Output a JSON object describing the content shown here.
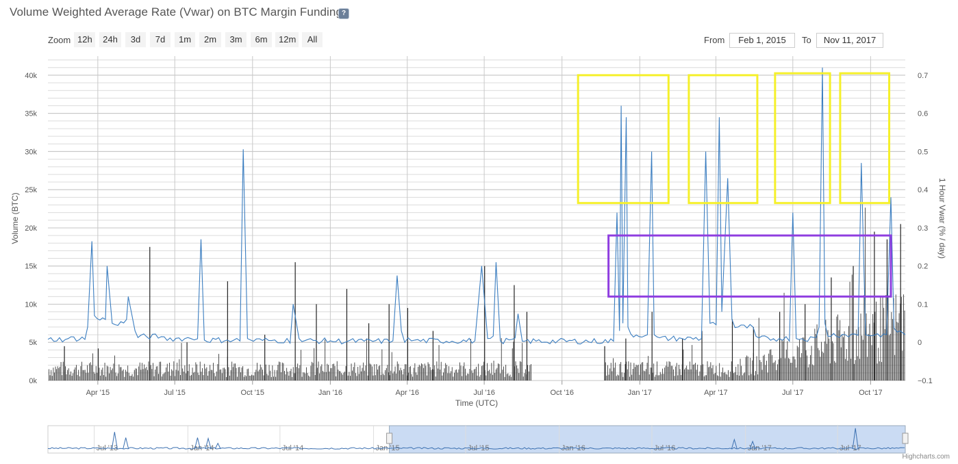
{
  "header": {
    "title": "Volume Weighted Average Rate (Vwar) on BTC Margin Funding",
    "help_icon": "help-icon"
  },
  "zoom": {
    "label": "Zoom",
    "buttons": [
      "12h",
      "24h",
      "3d",
      "7d",
      "1m",
      "2m",
      "3m",
      "6m",
      "12m",
      "All"
    ]
  },
  "range": {
    "from_label": "From",
    "from_value": "Feb 1, 2015",
    "to_label": "To",
    "to_value": "Nov 11, 2017"
  },
  "credits": "Highcharts.com",
  "chart_data": {
    "type": "line",
    "xlabel": "Time (UTC)",
    "x_ticks": [
      "Apr '15",
      "Jul '15",
      "Oct '15",
      "Jan '16",
      "Apr '16",
      "Jul '16",
      "Oct '16",
      "Jan '17",
      "Apr '17",
      "Jul '17",
      "Oct '17"
    ],
    "xlim": [
      "2015-02-01",
      "2017-11-11"
    ],
    "y_left": {
      "label": "Volume (BTC)",
      "ticks": [
        "0k",
        "5k",
        "10k",
        "15k",
        "20k",
        "25k",
        "30k",
        "35k",
        "40k"
      ],
      "ylim": [
        0,
        42500
      ]
    },
    "y_right": {
      "label": "1 Hour Vwar (% / day)",
      "ticks": [
        "−0.1",
        "0",
        "0.1",
        "0.2",
        "0.3",
        "0.4",
        "0.5",
        "0.6",
        "0.7"
      ],
      "ylim": [
        -0.1,
        0.75
      ]
    },
    "grid": true,
    "series": [
      {
        "type": "column",
        "axis": "left",
        "color": "#333333",
        "peaks": [
          [
            "2015-02-20",
            4500
          ],
          [
            "2015-04-01",
            4200
          ],
          [
            "2015-06-01",
            17500
          ],
          [
            "2015-07-15",
            5000
          ],
          [
            "2015-09-01",
            13000
          ],
          [
            "2015-10-15",
            6000
          ],
          [
            "2015-11-20",
            15500
          ],
          [
            "2015-12-15",
            10000
          ],
          [
            "2016-01-20",
            12000
          ],
          [
            "2016-02-15",
            7500
          ],
          [
            "2016-03-10",
            10000
          ],
          [
            "2016-04-01",
            9500
          ],
          [
            "2016-05-01",
            6500
          ],
          [
            "2016-07-01",
            15000
          ],
          [
            "2016-08-05",
            12500
          ],
          [
            "2016-08-20",
            9000
          ],
          [
            "2016-11-20",
            4500
          ],
          [
            "2016-12-15",
            5500
          ],
          [
            "2017-01-15",
            9000
          ],
          [
            "2017-02-20",
            5500
          ],
          [
            "2017-03-15",
            6500
          ],
          [
            "2017-04-20",
            8000
          ],
          [
            "2017-05-15",
            7000
          ],
          [
            "2017-06-15",
            9000
          ],
          [
            "2017-07-15",
            10000
          ],
          [
            "2017-08-15",
            13500
          ],
          [
            "2017-09-10",
            15000
          ],
          [
            "2017-10-05",
            19500
          ],
          [
            "2017-10-20",
            18500
          ],
          [
            "2017-11-05",
            20500
          ]
        ]
      },
      {
        "type": "line",
        "axis": "right",
        "color": "#3a7dc0",
        "points": [
          [
            "2015-02-01",
            0.008
          ],
          [
            "2015-02-25",
            0.01
          ],
          [
            "2015-03-20",
            0.04
          ],
          [
            "2015-03-25",
            0.265
          ],
          [
            "2015-03-28",
            0.07
          ],
          [
            "2015-04-10",
            0.06
          ],
          [
            "2015-04-12",
            0.2
          ],
          [
            "2015-04-18",
            0.05
          ],
          [
            "2015-05-05",
            0.06
          ],
          [
            "2015-05-07",
            0.12
          ],
          [
            "2015-05-15",
            0.03
          ],
          [
            "2015-06-15",
            0.015
          ],
          [
            "2015-07-20",
            0.01
          ],
          [
            "2015-08-01",
            0.27
          ],
          [
            "2015-08-05",
            0.006
          ],
          [
            "2015-09-01",
            0.006
          ],
          [
            "2015-09-20",
            0.506
          ],
          [
            "2015-09-25",
            0.01
          ],
          [
            "2015-10-20",
            0.005
          ],
          [
            "2015-11-18",
            0.1
          ],
          [
            "2015-11-25",
            0.01
          ],
          [
            "2016-01-01",
            0.004
          ],
          [
            "2016-02-10",
            0.003
          ],
          [
            "2016-03-15",
            0.004
          ],
          [
            "2016-03-20",
            0.175
          ],
          [
            "2016-03-25",
            0.03
          ],
          [
            "2016-04-10",
            0.006
          ],
          [
            "2016-06-20",
            0.004
          ],
          [
            "2016-06-28",
            0.2
          ],
          [
            "2016-07-05",
            0.01
          ],
          [
            "2016-07-15",
            0.21
          ],
          [
            "2016-07-20",
            0.004
          ],
          [
            "2016-08-10",
            0.075
          ],
          [
            "2016-08-15",
            0.003
          ],
          [
            "2016-12-01",
            0.003
          ],
          [
            "2016-12-05",
            0.34
          ],
          [
            "2016-12-08",
            0.03
          ],
          [
            "2016-12-10",
            0.62
          ],
          [
            "2016-12-12",
            0.05
          ],
          [
            "2016-12-16",
            0.59
          ],
          [
            "2016-12-18",
            0.04
          ],
          [
            "2017-01-10",
            0.02
          ],
          [
            "2017-01-15",
            0.5
          ],
          [
            "2017-01-18",
            0.02
          ],
          [
            "2017-02-20",
            0.01
          ],
          [
            "2017-03-15",
            0.01
          ],
          [
            "2017-03-20",
            0.5
          ],
          [
            "2017-03-25",
            0.05
          ],
          [
            "2017-04-05",
            0.59
          ],
          [
            "2017-04-08",
            0.08
          ],
          [
            "2017-04-15",
            0.43
          ],
          [
            "2017-04-20",
            0.06
          ],
          [
            "2017-05-15",
            0.04
          ],
          [
            "2017-06-15",
            0.01
          ],
          [
            "2017-07-01",
            0.34
          ],
          [
            "2017-07-05",
            0.01
          ],
          [
            "2017-08-01",
            0.04
          ],
          [
            "2017-08-05",
            0.72
          ],
          [
            "2017-08-08",
            0.05
          ],
          [
            "2017-09-01",
            0.02
          ],
          [
            "2017-09-20",
            0.47
          ],
          [
            "2017-09-25",
            0.02
          ],
          [
            "2017-10-20",
            0.02
          ],
          [
            "2017-10-25",
            0.38
          ],
          [
            "2017-11-05",
            0.03
          ],
          [
            "2017-11-11",
            0.02
          ]
        ]
      }
    ],
    "annotations": [
      {
        "shape": "rect",
        "color": "#f5f02a",
        "x": [
          "2016-10-20",
          "2017-02-04"
        ],
        "y_right": [
          0.365,
          0.7
        ]
      },
      {
        "shape": "rect",
        "color": "#f5f02a",
        "x": [
          "2017-02-28",
          "2017-05-20"
        ],
        "y_right": [
          0.365,
          0.7
        ]
      },
      {
        "shape": "rect",
        "color": "#f5f02a",
        "x": [
          "2017-06-10",
          "2017-08-14"
        ],
        "y_right": [
          0.365,
          0.705
        ]
      },
      {
        "shape": "rect",
        "color": "#f5f02a",
        "x": [
          "2017-08-26",
          "2017-10-23"
        ],
        "y_right": [
          0.365,
          0.705
        ]
      },
      {
        "shape": "rect",
        "color": "#8f3ee0",
        "x": [
          "2016-11-25",
          "2017-10-25"
        ],
        "y_right": [
          0.12,
          0.28
        ]
      }
    ],
    "navigator": {
      "x_ticks": [
        "Jul '13",
        "Jan '14",
        "Jul '14",
        "Jan '15",
        "Jul '15",
        "Jan '16",
        "Jul '16",
        "Jan '17",
        "Jul '17"
      ],
      "range": [
        "2013-04-01",
        "2017-11-11"
      ],
      "selected": [
        "2015-02-01",
        "2017-11-11"
      ]
    }
  }
}
